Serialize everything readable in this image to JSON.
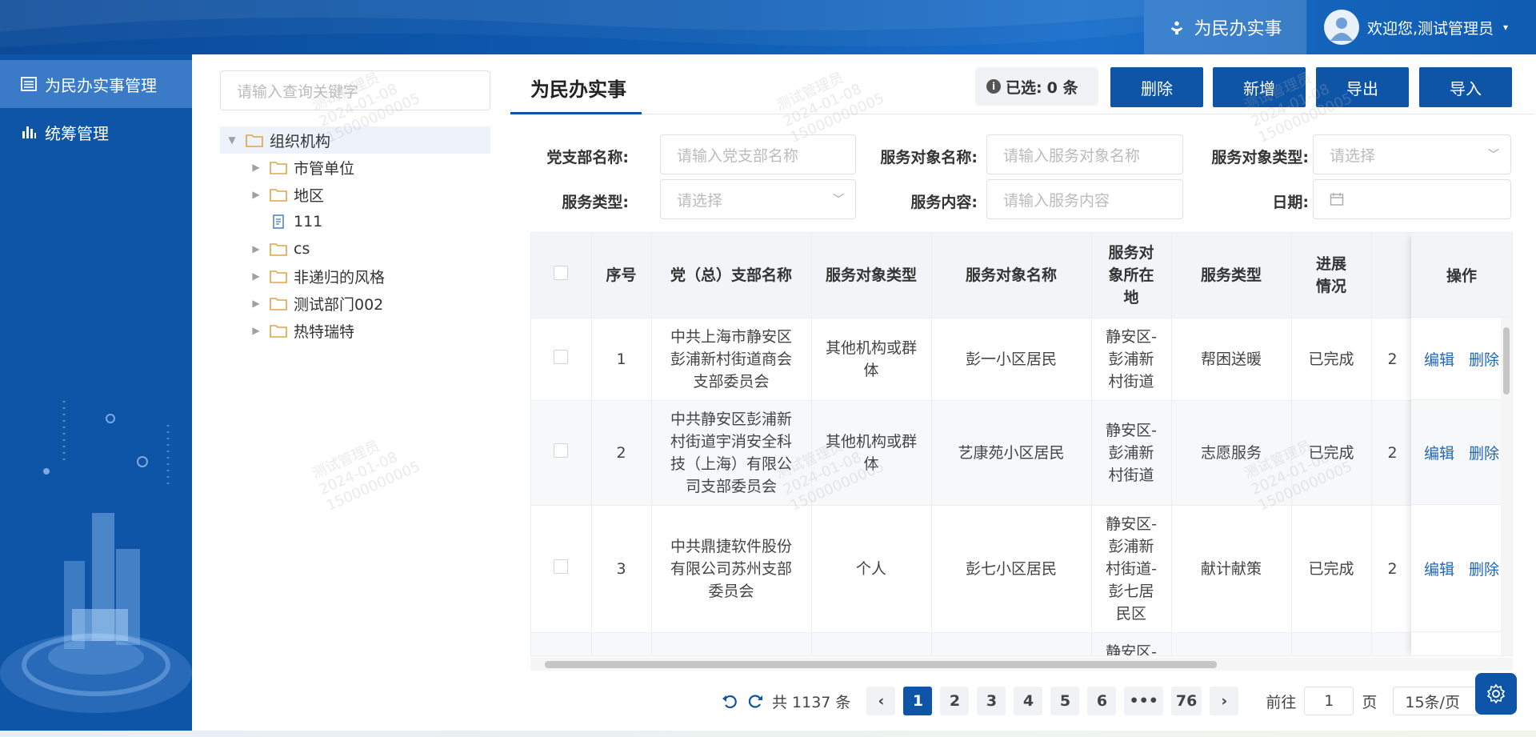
{
  "header": {
    "active_tab": "为民办实事",
    "user_greeting": "欢迎您,测试管理员",
    "caret": "▾"
  },
  "sidebar": {
    "items": [
      {
        "label": "为民办实事管理",
        "icon": "list-icon"
      },
      {
        "label": "统筹管理",
        "icon": "bar-chart-icon"
      }
    ]
  },
  "tree": {
    "search_placeholder": "请输入查询关键字",
    "root": "组织机构",
    "children": [
      "市管单位",
      "地区",
      "111",
      "cs",
      "非递归的风格",
      "测试部门002",
      "热特瑞特"
    ]
  },
  "main": {
    "title": "为民办实事",
    "selected_label": "已选:",
    "selected_count": "0 条",
    "buttons": {
      "delete": "删除",
      "add": "新增",
      "export": "导出",
      "import": "导入"
    }
  },
  "filters": {
    "branch_label": "党支部名称:",
    "branch_placeholder": "请输入党支部名称",
    "target_name_label": "服务对象名称:",
    "target_name_placeholder": "请输入服务对象名称",
    "target_type_label": "服务对象类型:",
    "target_type_placeholder": "请选择",
    "service_type_label": "服务类型:",
    "service_type_placeholder": "请选择",
    "content_label": "服务内容:",
    "content_placeholder": "请输入服务内容",
    "date_label": "日期:"
  },
  "table": {
    "headers": [
      "序号",
      "党（总）支部名称",
      "服务对象类型",
      "服务对象名称",
      "服务对象所在地",
      "服务类型",
      "进展情况",
      "操作"
    ],
    "rows": [
      {
        "no": "1",
        "branch": "中共上海市静安区彭浦新村街道商会支部委员会",
        "target_type": "其他机构或群体",
        "target_name": "彭一小区居民",
        "location": "静安区-彭浦新村街道",
        "service_type": "帮困送暖",
        "progress": "已完成",
        "extra": "2"
      },
      {
        "no": "2",
        "branch": "中共静安区彭浦新村街道宇消安全科技（上海）有限公司支部委员会",
        "target_type": "其他机构或群体",
        "target_name": "艺康苑小区居民",
        "location": "静安区-彭浦新村街道",
        "service_type": "志愿服务",
        "progress": "已完成",
        "extra": "2"
      },
      {
        "no": "3",
        "branch": "中共鼎捷软件股份有限公司苏州支部委员会",
        "target_type": "个人",
        "target_name": "彭七小区居民",
        "location": "静安区-彭浦新村街道-彭七居民区",
        "service_type": "献计献策",
        "progress": "已完成",
        "extra": "2"
      },
      {
        "no": "",
        "branch": "",
        "target_type": "",
        "target_name": "",
        "location": "静安区-",
        "service_type": "",
        "progress": "",
        "extra": ""
      }
    ],
    "edit_label": "编辑",
    "delete_label": "删除"
  },
  "pagination": {
    "total": "共 1137 条",
    "pages": [
      "1",
      "2",
      "3",
      "4",
      "5",
      "6",
      "•••",
      "76"
    ],
    "goto_label": "前往",
    "goto_value": "1",
    "page_unit": "页",
    "page_size": "15条/页"
  },
  "watermark": {
    "line1": "测试管理员",
    "line2": "2024-01-08",
    "line3": "15000000005"
  },
  "colors": {
    "primary": "#0e55a7",
    "link": "#1f67b8",
    "header_bg": "#f2f4f7"
  }
}
